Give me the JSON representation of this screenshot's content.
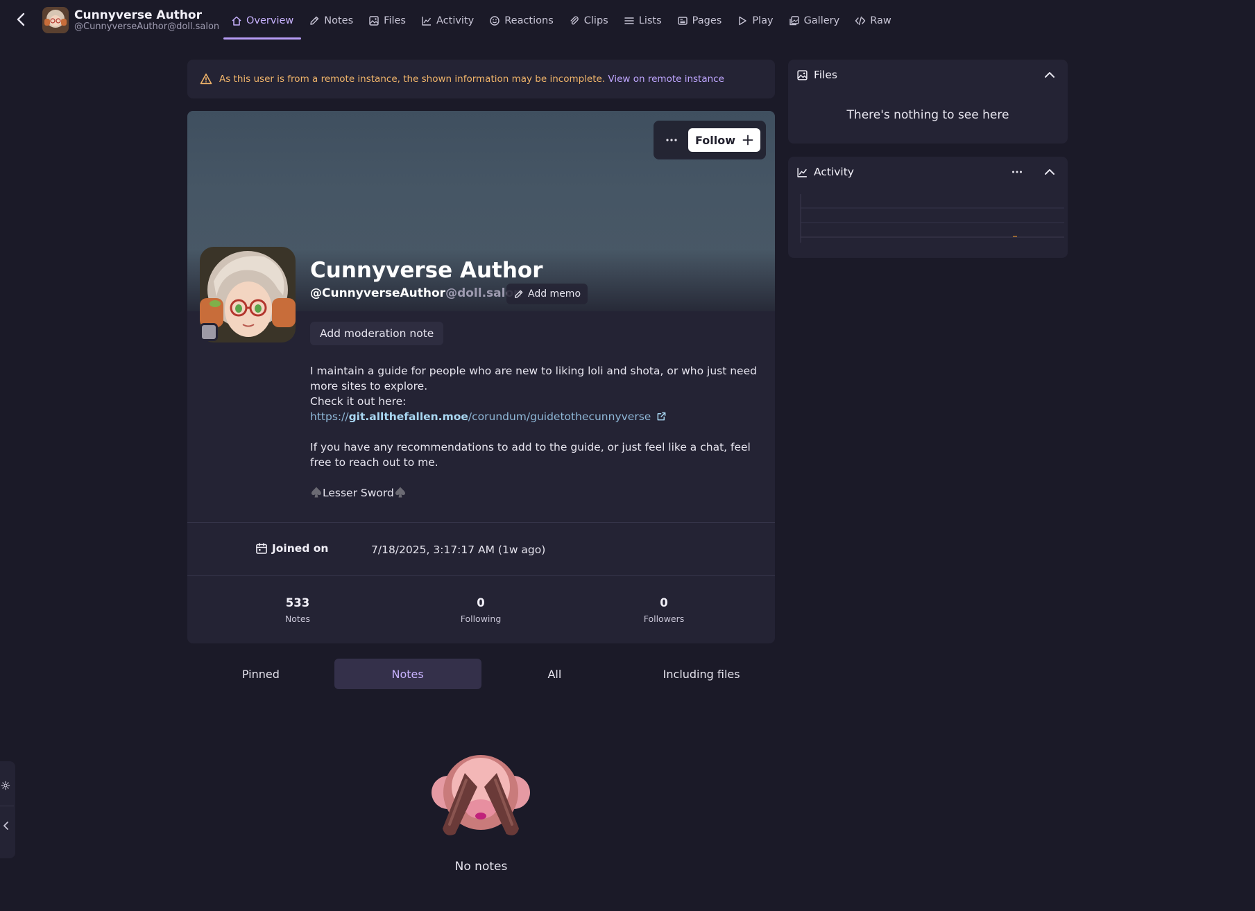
{
  "header": {
    "display_name": "Cunnyverse Author",
    "account": "@CunnyverseAuthor@doll.salon"
  },
  "tabs": [
    {
      "label": "Overview",
      "icon": "home-icon",
      "active": true
    },
    {
      "label": "Notes",
      "icon": "pencil-icon"
    },
    {
      "label": "Files",
      "icon": "image-icon"
    },
    {
      "label": "Activity",
      "icon": "chart-line-icon"
    },
    {
      "label": "Reactions",
      "icon": "mood-smile-icon"
    },
    {
      "label": "Clips",
      "icon": "paperclip-icon"
    },
    {
      "label": "Lists",
      "icon": "list-icon"
    },
    {
      "label": "Pages",
      "icon": "news-icon"
    },
    {
      "label": "Play",
      "icon": "play-icon"
    },
    {
      "label": "Gallery",
      "icon": "photos-icon"
    },
    {
      "label": "Raw",
      "icon": "code-icon"
    }
  ],
  "notice": {
    "text": "As this user is from a remote instance, the shown information may be incomplete.",
    "link": "View on remote instance"
  },
  "profile": {
    "name": "Cunnyverse Author",
    "username": "@CunnyverseAuthor",
    "host": "@doll.salon",
    "add_memo": "Add memo",
    "follow_label": "Follow",
    "add_moderation_note": "Add moderation note",
    "bio": {
      "line1": "I maintain a guide for people who are new to liking loli and shota, or who just need more sites to explore.",
      "line2": "Check it out here:",
      "url_scheme": "https://",
      "url_domain": "git.allthefallen.moe",
      "url_path": "/corundum/guidetothecunnyverse",
      "line3": "If you have any recommendations to add to the guide, or just feel like a chat, feel free to reach out to me.",
      "signature": "Lesser Sword"
    },
    "joined_label": "Joined on",
    "joined_value": "7/18/2025, 3:17:17 AM (1w ago)",
    "stats": {
      "notes_count": "533",
      "notes_label": "Notes",
      "following_count": "0",
      "following_label": "Following",
      "followers_count": "0",
      "followers_label": "Followers"
    }
  },
  "note_tabs": [
    {
      "label": "Pinned"
    },
    {
      "label": "Notes",
      "active": true
    },
    {
      "label": "All"
    },
    {
      "label": "Including files"
    }
  ],
  "empty_state": "No notes",
  "widgets": {
    "files": {
      "title": "Files",
      "empty": "There's nothing to see here"
    },
    "activity": {
      "title": "Activity"
    }
  },
  "colors": {
    "background": "#1b1a28",
    "panel": "#242334",
    "accent": "#b69cf5",
    "warning": "#f0b46a"
  }
}
